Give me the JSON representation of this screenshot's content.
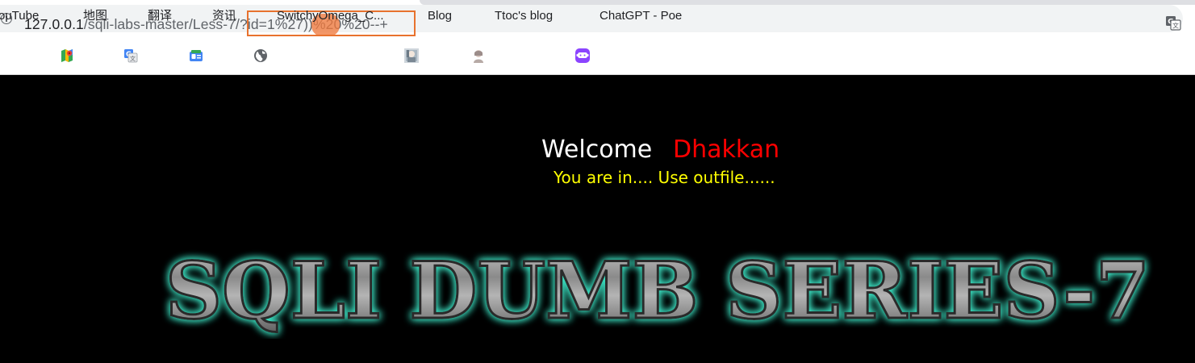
{
  "browser": {
    "url_host": "127.0.0.1",
    "url_path": "/sqli-labs-master/Less-7/?id=1%27))%20%20--+",
    "bookmarks": [
      {
        "label": "ouTube",
        "icon": "youtube-icon"
      },
      {
        "label": "地图",
        "icon": "maps-icon"
      },
      {
        "label": "翻译",
        "icon": "translate-icon"
      },
      {
        "label": "资讯",
        "icon": "news-icon"
      },
      {
        "label": "SwitchyOmega_C...",
        "icon": "globe-icon"
      },
      {
        "label": "Blog",
        "icon": "blog-avatar-icon"
      },
      {
        "label": "Ttoc's blog",
        "icon": "avatar-icon"
      },
      {
        "label": "ChatGPT - Poe",
        "icon": "poe-icon"
      }
    ]
  },
  "page": {
    "welcome_label": "Welcome",
    "welcome_name": "Dhakkan",
    "message": "You are in.... Use outfile......",
    "title": "SQLI DUMB SERIES-7"
  },
  "colors": {
    "welcome": "#ffffff",
    "name": "#ff0000",
    "message": "#ffff00",
    "title_glow": "#3ee8c8",
    "highlight": "#e8722e"
  }
}
